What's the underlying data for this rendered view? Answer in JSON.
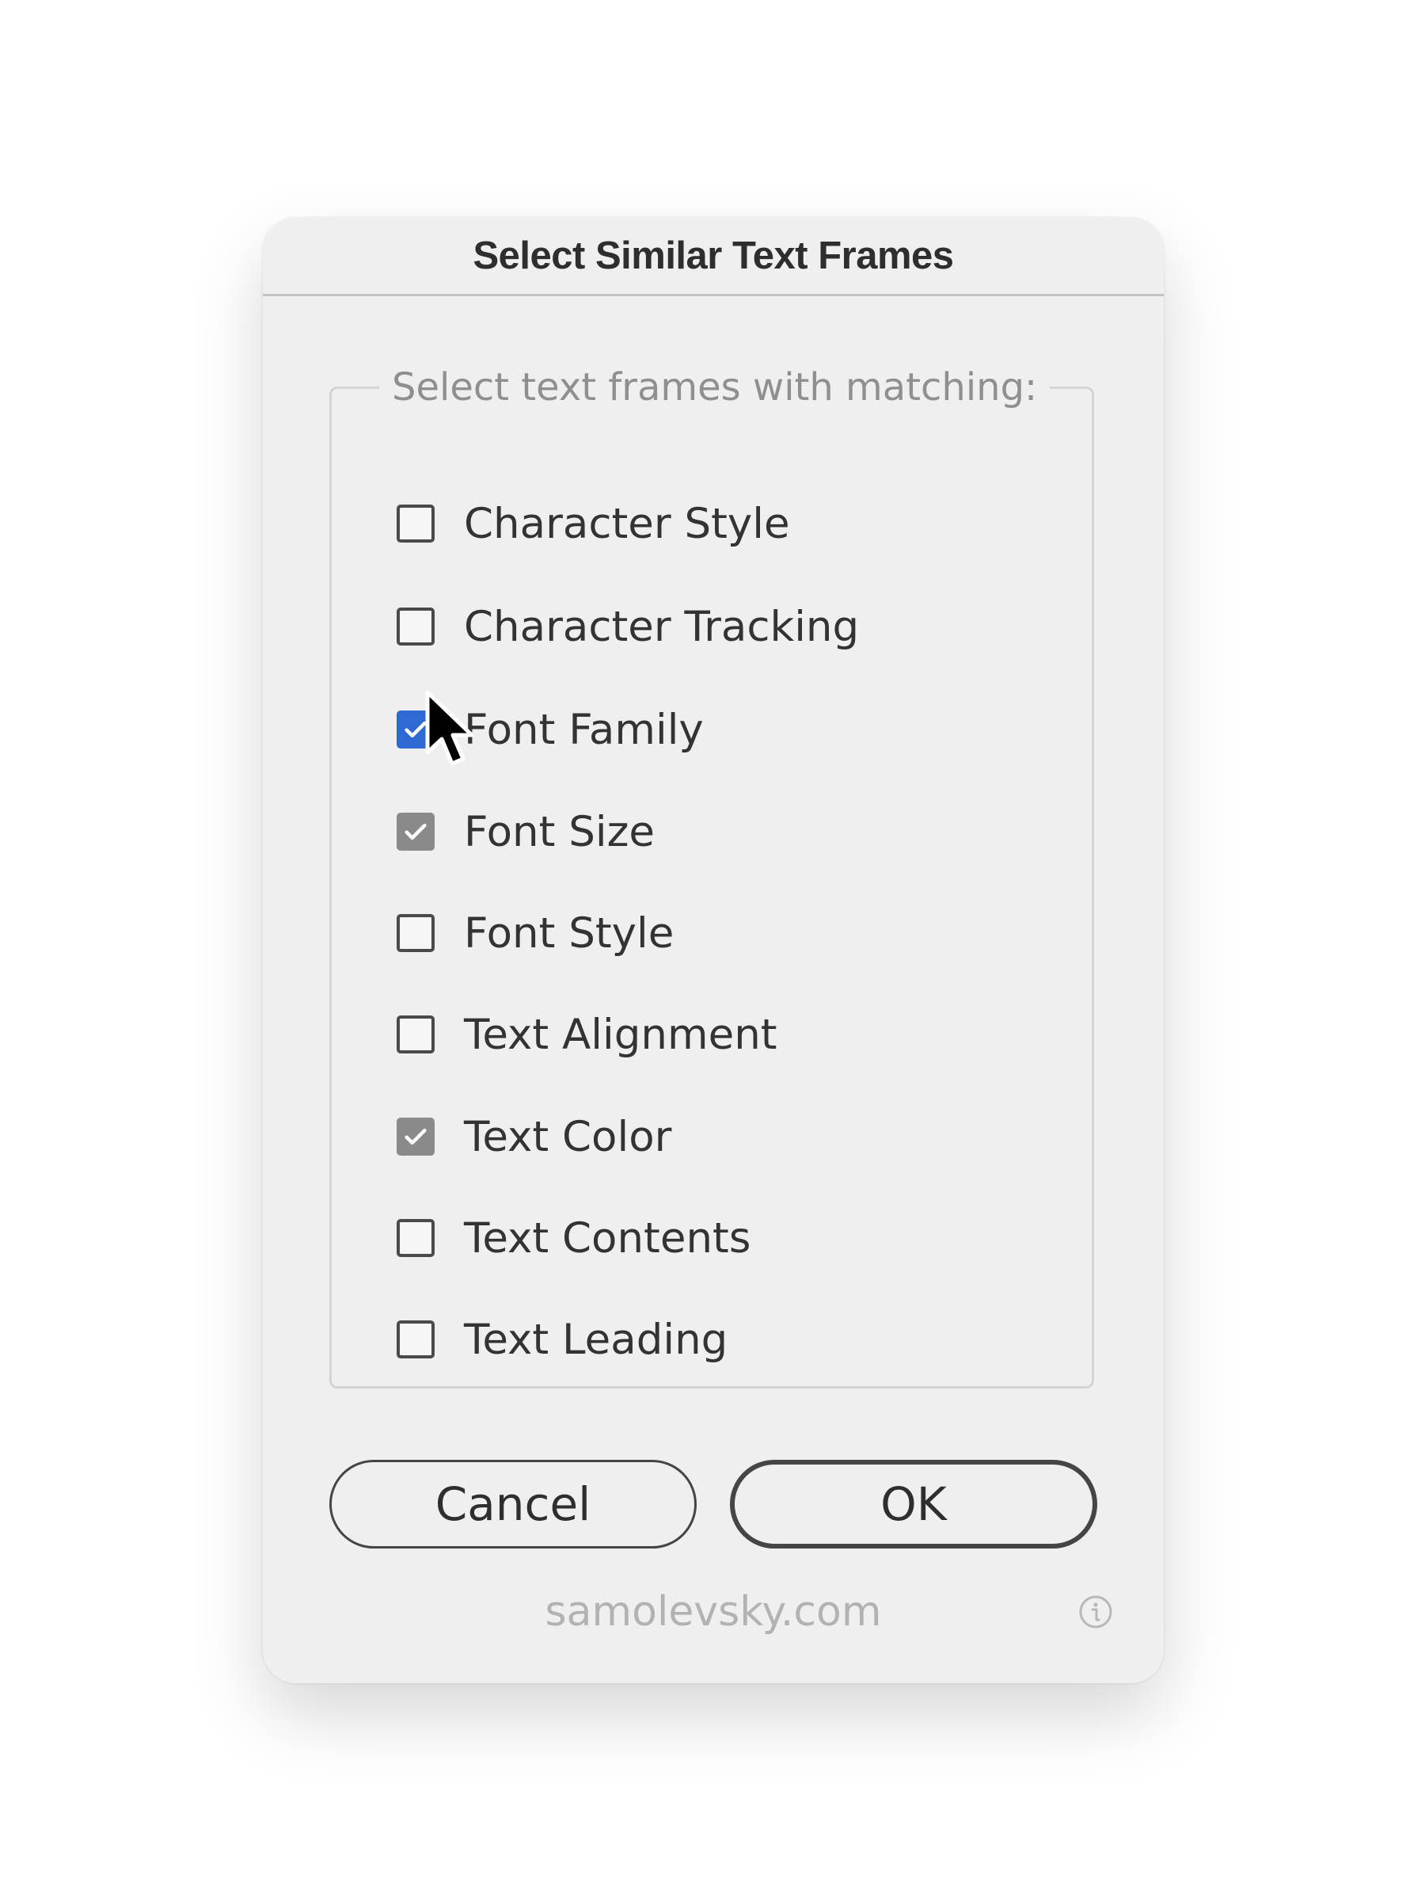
{
  "dialog": {
    "title": "Select Similar Text Frames",
    "group_label": "Select text frames with matching:",
    "options": [
      {
        "label": "Character Style",
        "checked": false
      },
      {
        "label": "Character Tracking",
        "checked": false
      },
      {
        "label": "Font Family",
        "checked": true,
        "state": "focused"
      },
      {
        "label": "Font Size",
        "checked": true
      },
      {
        "label": "Font Style",
        "checked": false
      },
      {
        "label": "Text Alignment",
        "checked": false
      },
      {
        "label": "Text Color",
        "checked": true
      },
      {
        "label": "Text Contents",
        "checked": false
      },
      {
        "label": "Text Leading",
        "checked": false
      }
    ],
    "buttons": {
      "cancel": "Cancel",
      "ok": "OK"
    },
    "footer": "samolevsky.com",
    "icons": {
      "info": "info-icon",
      "checkmark": "checkmark-icon",
      "cursor": "mouse-pointer-icon"
    }
  },
  "colors": {
    "checked_accent": "#2f6ad4",
    "checked_gray": "#8a8a8a",
    "background": "#efefef"
  }
}
